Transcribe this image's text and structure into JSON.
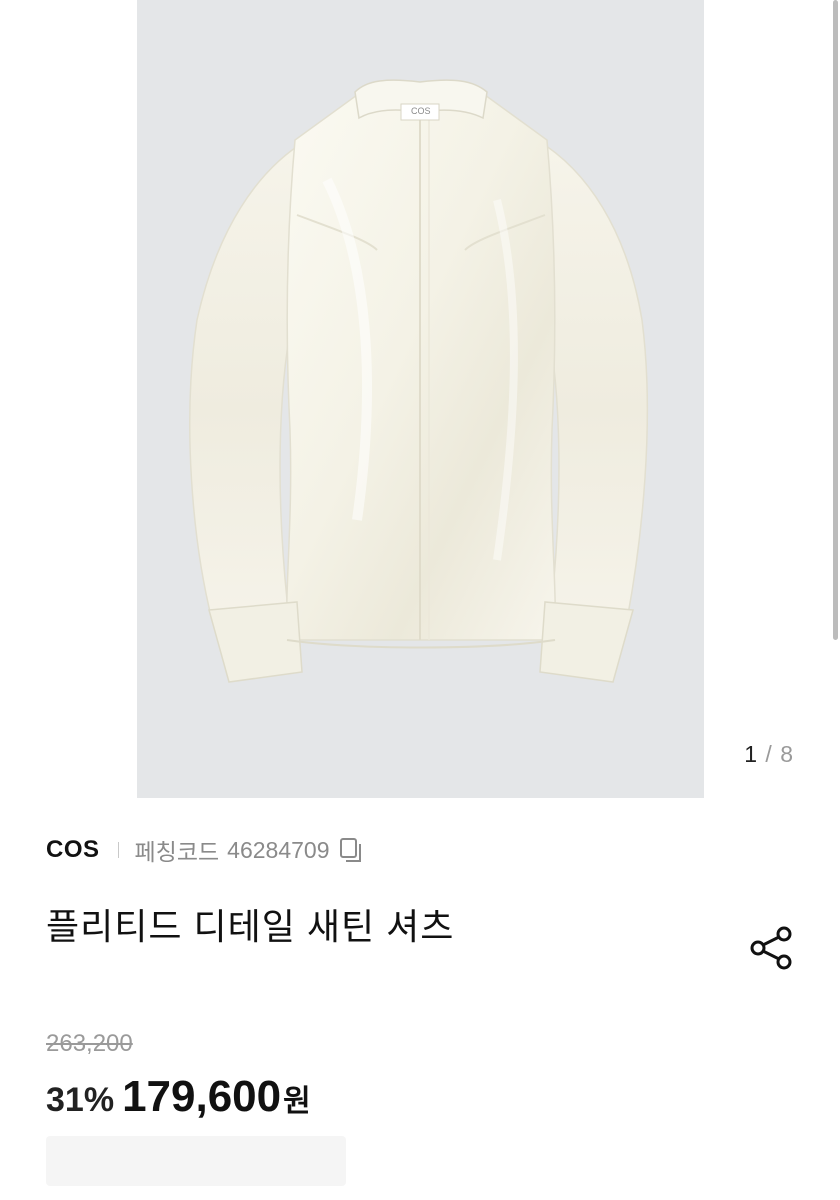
{
  "gallery": {
    "image_alt": "COS pleated detail satin shirt",
    "tag_text": "COS",
    "current": "1",
    "separator": "/",
    "total": "8"
  },
  "product": {
    "brand": "COS",
    "code_label": "페칭코드",
    "code_value": "46284709",
    "title": "플리티드 디테일 새틴 셔츠",
    "original_price": "263,200",
    "discount": "31%",
    "price": "179,600",
    "currency": "원"
  },
  "icons": {
    "copy": "copy-icon",
    "share": "share-icon"
  },
  "colors": {
    "photo_background": "#e4e6e8",
    "shirt": "#f6f4ea",
    "text_primary": "#111111",
    "text_muted": "#8a8a8a"
  }
}
